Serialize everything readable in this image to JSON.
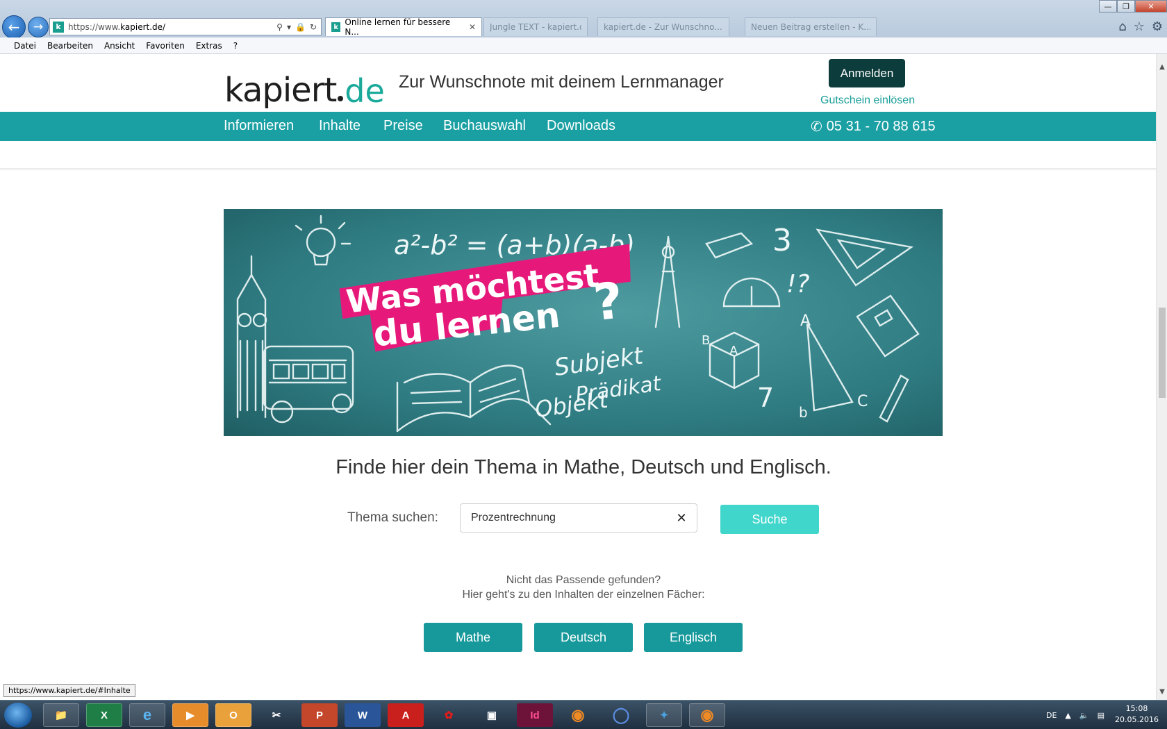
{
  "browser": {
    "url_prefix": "https://www.",
    "url_domain": "kapiert.de/",
    "active_tab_title": "Online lernen für bessere N...",
    "inactive_tabs": [
      "Jungle TEXT - kapiert.de",
      "kapiert.de - Zur Wunschno...",
      "Neuen Beitrag erstellen - K..."
    ],
    "menu": [
      "Datei",
      "Bearbeiten",
      "Ansicht",
      "Favoriten",
      "Extras",
      "?"
    ],
    "status_url": "https://www.kapiert.de/#Inhalte"
  },
  "site": {
    "logo_left": "kapiert",
    "logo_right": "de",
    "tagline": "Zur Wunschnote mit deinem Lernmanager",
    "login_label": "Anmelden",
    "voucher_label": "Gutschein einlösen",
    "nav": [
      "Informieren",
      "Inhalte",
      "Preise",
      "Buchauswahl",
      "Downloads"
    ],
    "phone": "05 31 - 70 88 615"
  },
  "banner": {
    "line1": "Was möchtest",
    "line2": "du lernen",
    "qmark": "?",
    "formula": "a²-b² = (a+b)(a-b)",
    "words": [
      "Subjekt",
      "Prädikat",
      "Objekt"
    ],
    "number3": "3",
    "number7": "7",
    "excl": "!?",
    "tri_a": "A",
    "tri_b": "b",
    "tri_c": "C",
    "cube_a": "A",
    "cube_b": "B"
  },
  "search": {
    "title": "Finde hier dein Thema in Mathe, Deutsch und Englisch.",
    "label": "Thema suchen:",
    "value": "Prozentrechnung",
    "button": "Suche",
    "hint_line1": "Nicht das Passende gefunden?",
    "hint_line2": "Hier geht's zu den Inhalten der einzelnen Fächer:",
    "subjects": [
      "Mathe",
      "Deutsch",
      "Englisch"
    ]
  },
  "taskbar": {
    "lang": "DE",
    "time": "15:08",
    "date": "20.05.2016"
  },
  "colors": {
    "teal": "#1a9fa3",
    "dark_teal": "#0c3c3b",
    "search_btn": "#41d6cb",
    "banner_pink": "#e6197a"
  }
}
